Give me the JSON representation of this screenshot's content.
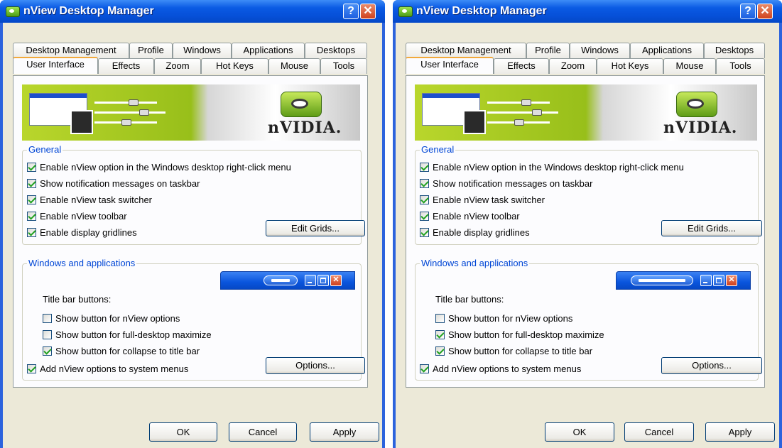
{
  "windows": [
    {
      "title": "nView Desktop Manager",
      "tabs_back": [
        "Desktop Management",
        "Profile",
        "Windows",
        "Applications",
        "Desktops"
      ],
      "tabs_front": [
        "User Interface",
        "Effects",
        "Zoom",
        "Hot Keys",
        "Mouse",
        "Tools"
      ],
      "active_tab": "User Interface",
      "banner_brand": "nVIDIA.",
      "general": {
        "legend": "General",
        "options": [
          {
            "label": "Enable nView option in the Windows desktop right-click menu",
            "checked": true
          },
          {
            "label": "Show notification messages on taskbar",
            "checked": true
          },
          {
            "label": "Enable nView task switcher",
            "checked": true
          },
          {
            "label": "Enable nView toolbar",
            "checked": true
          },
          {
            "label": "Enable display gridlines",
            "checked": true
          }
        ],
        "edit_grids_label": "Edit Grids..."
      },
      "windows_apps": {
        "legend": "Windows and applications",
        "title_bar_label": "Title bar buttons:",
        "options": [
          {
            "label": "Show button for nView options",
            "checked": false
          },
          {
            "label": "Show button for full-desktop maximize",
            "checked": false
          },
          {
            "label": "Show button for collapse to title bar",
            "checked": true
          }
        ],
        "system_menu": {
          "label": "Add nView options to system menus",
          "checked": true
        },
        "options_label": "Options..."
      },
      "buttons": {
        "ok": "OK",
        "cancel": "Cancel",
        "apply": "Apply"
      }
    },
    {
      "title": "nView Desktop Manager",
      "tabs_back": [
        "Desktop Management",
        "Profile",
        "Windows",
        "Applications",
        "Desktops"
      ],
      "tabs_front": [
        "User Interface",
        "Effects",
        "Zoom",
        "Hot Keys",
        "Mouse",
        "Tools"
      ],
      "active_tab": "User Interface",
      "banner_brand": "nVIDIA.",
      "general": {
        "legend": "General",
        "options": [
          {
            "label": "Enable nView option in the Windows desktop right-click menu",
            "checked": true
          },
          {
            "label": "Show notification messages on taskbar",
            "checked": true
          },
          {
            "label": "Enable nView task switcher",
            "checked": true
          },
          {
            "label": "Enable nView toolbar",
            "checked": true
          },
          {
            "label": "Enable display gridlines",
            "checked": true
          }
        ],
        "edit_grids_label": "Edit Grids..."
      },
      "windows_apps": {
        "legend": "Windows and applications",
        "title_bar_label": "Title bar buttons:",
        "options": [
          {
            "label": "Show button for nView options",
            "checked": false
          },
          {
            "label": "Show button for full-desktop maximize",
            "checked": true
          },
          {
            "label": "Show button for collapse to title bar",
            "checked": true
          }
        ],
        "system_menu": {
          "label": "Add nView options to system menus",
          "checked": true
        },
        "options_label": "Options..."
      },
      "buttons": {
        "ok": "OK",
        "cancel": "Cancel",
        "apply": "Apply"
      }
    }
  ]
}
